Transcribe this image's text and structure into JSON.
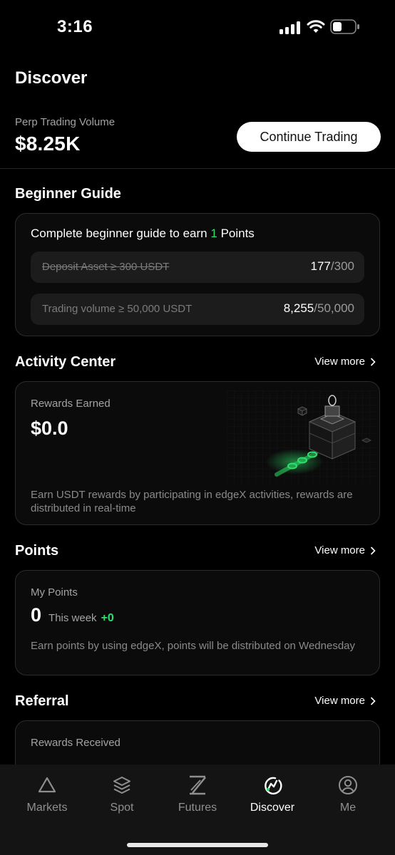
{
  "status_bar": {
    "time": "3:16"
  },
  "header": {
    "title": "Discover",
    "volume_label": "Perp Trading Volume",
    "volume_value": "$8.25K",
    "continue_label": "Continue Trading"
  },
  "beginner_guide": {
    "title": "Beginner Guide",
    "heading_prefix": "Complete beginner guide to earn",
    "heading_points": "1",
    "heading_suffix": "Points",
    "tasks": [
      {
        "label": "Deposit Asset ≥ 300 USDT",
        "current": "177",
        "separator": "/",
        "total": "300",
        "completed": true
      },
      {
        "label": "Trading volume ≥ 50,000 USDT",
        "current": "8,255",
        "separator": "/",
        "total": "50,000",
        "completed": false
      }
    ]
  },
  "activity_center": {
    "title": "Activity Center",
    "view_more": "View more",
    "rewards_label": "Rewards Earned",
    "rewards_value": "$0.0",
    "description": "Earn USDT rewards by participating in edgeX activities, rewards are distributed in real-time"
  },
  "points": {
    "title": "Points",
    "view_more": "View more",
    "label": "My Points",
    "value": "0",
    "week_label": "This week",
    "week_delta": "+0",
    "description": "Earn points by using edgeX, points will be distributed on Wednesday"
  },
  "referral": {
    "title": "Referral",
    "view_more": "View more",
    "rewards_label": "Rewards Received"
  },
  "bottom_nav": {
    "items": [
      {
        "label": "Markets",
        "icon": "triangle-icon"
      },
      {
        "label": "Spot",
        "icon": "layers-icon"
      },
      {
        "label": "Futures",
        "icon": "z-logo-icon"
      },
      {
        "label": "Discover",
        "icon": "compass-icon",
        "active": true
      },
      {
        "label": "Me",
        "icon": "user-icon"
      }
    ]
  },
  "colors": {
    "accent_green": "#2ee06a",
    "background": "#000000",
    "card": "#0b0b0b"
  }
}
